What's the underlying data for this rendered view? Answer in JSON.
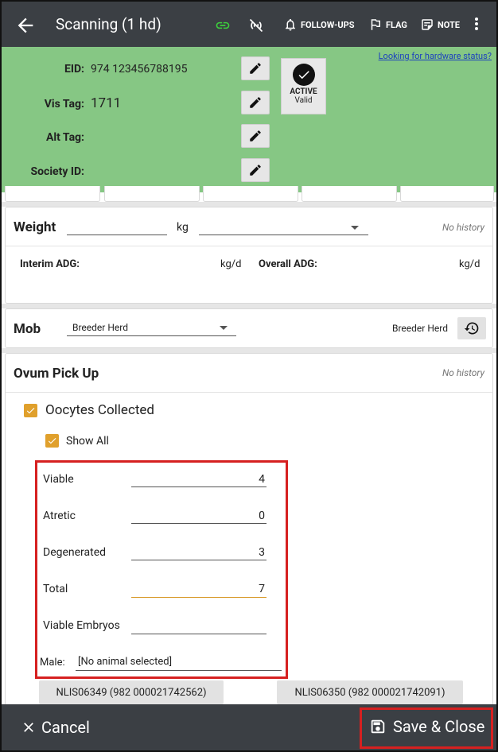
{
  "header": {
    "title": "Scanning (1 hd)",
    "follow_ups": "FOLLOW-UPS",
    "flag": "FLAG",
    "note": "NOTE",
    "link_icon_color": "#3cd13c"
  },
  "identity": {
    "hardware_link": "Looking for hardware status?",
    "eid_label": "EID:",
    "eid_value": "974 123456788195",
    "vis_tag_label": "Vis Tag:",
    "vis_tag_value": "1711",
    "alt_tag_label": "Alt Tag:",
    "alt_tag_value": "",
    "society_label": "Society ID:",
    "society_value": "",
    "status_title": "ACTIVE",
    "status_sub": "Valid",
    "background": "#86c784"
  },
  "weight": {
    "title": "Weight",
    "value": "",
    "unit": "kg",
    "dropdown_value": "",
    "history": "No history",
    "interim_label": "Interim ADG:",
    "interim_unit": "kg/d",
    "overall_label": "Overall ADG:",
    "overall_unit": "kg/d"
  },
  "mob": {
    "title": "Mob",
    "selected": "Breeder Herd",
    "current": "Breeder Herd"
  },
  "ovum": {
    "title": "Ovum Pick Up",
    "history": "No history",
    "oocytes_label": "Oocytes Collected",
    "oocytes_checked": true,
    "show_all_label": "Show All",
    "show_all_checked": true,
    "fields": [
      {
        "label": "Viable",
        "value": "4"
      },
      {
        "label": "Atretic",
        "value": "0"
      },
      {
        "label": "Degenerated",
        "value": "3"
      },
      {
        "label": "Total",
        "value": "7"
      },
      {
        "label": "Viable Embryos",
        "value": ""
      }
    ],
    "male_label": "Male:",
    "male_value": "[No animal selected]",
    "animal_buttons": [
      "NLIS06349 (982 000021742562)",
      "NLIS06350 (982 000021742091)"
    ],
    "checkbox_color": "#e0a02c",
    "highlight_color": "#d62020"
  },
  "footer": {
    "cancel": "Cancel",
    "save": "Save & Close"
  }
}
